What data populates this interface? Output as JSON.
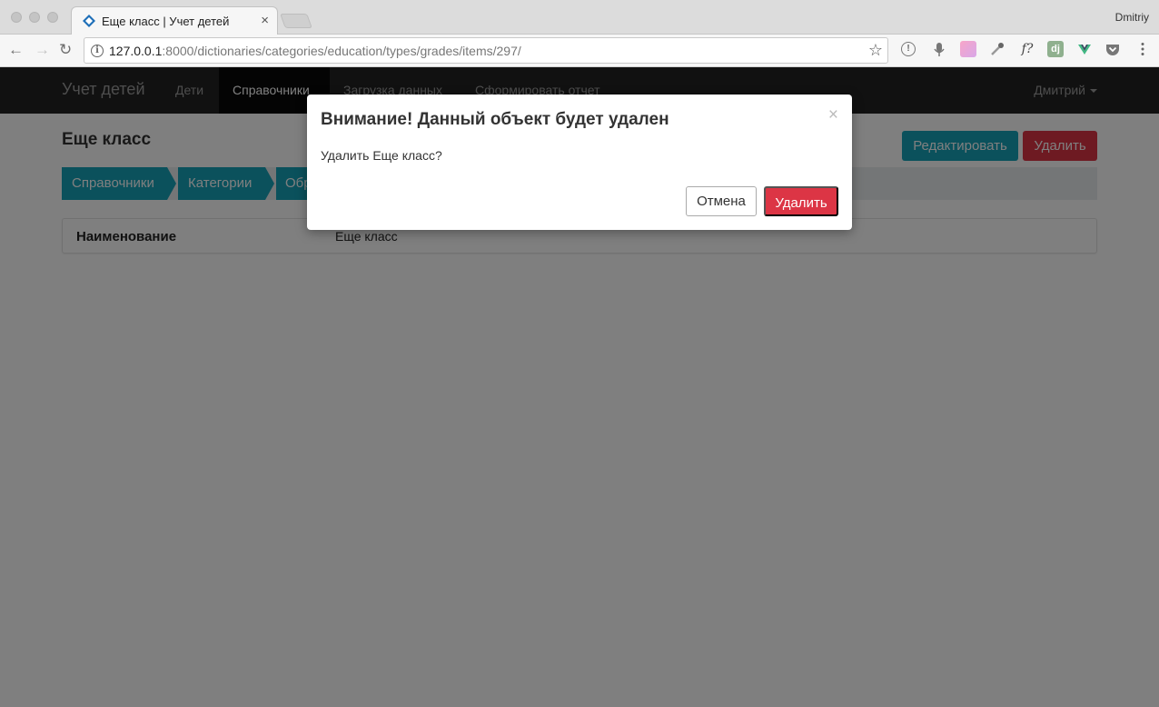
{
  "browser": {
    "tab_title": "Еще класс | Учет детей",
    "tab_close": "×",
    "profile_name": "Dmitriy",
    "url_host": "127.0.0.1",
    "url_rest": ":8000/dictionaries/categories/education/types/grades/items/297/",
    "star": "☆",
    "nav": {
      "back": "←",
      "forward": "→",
      "reload": "↻"
    },
    "extensions": {
      "info": "i",
      "mic": "🎙",
      "fx": "f?",
      "django": "dj"
    }
  },
  "navbar": {
    "brand": "Учет детей",
    "links": [
      "Дети",
      "Справочники",
      "Загрузка данных",
      "Сформировать отчет"
    ],
    "active_index": 1,
    "user": "Дмитрий"
  },
  "page": {
    "title": "Еще класс",
    "edit_label": "Редактировать",
    "delete_label": "Удалить",
    "breadcrumbs": [
      "Справочники",
      "Категории",
      "Образование"
    ],
    "fields": [
      {
        "label": "Наименование",
        "value": "Еще класс"
      }
    ]
  },
  "modal": {
    "title": "Внимание! Данный объект будет удален",
    "close": "×",
    "body": "Удалить Еще класс?",
    "cancel_label": "Отмена",
    "confirm_label": "Удалить"
  },
  "colors": {
    "info": "#17a2b8",
    "danger": "#dc3545",
    "navbar": "#222222"
  }
}
